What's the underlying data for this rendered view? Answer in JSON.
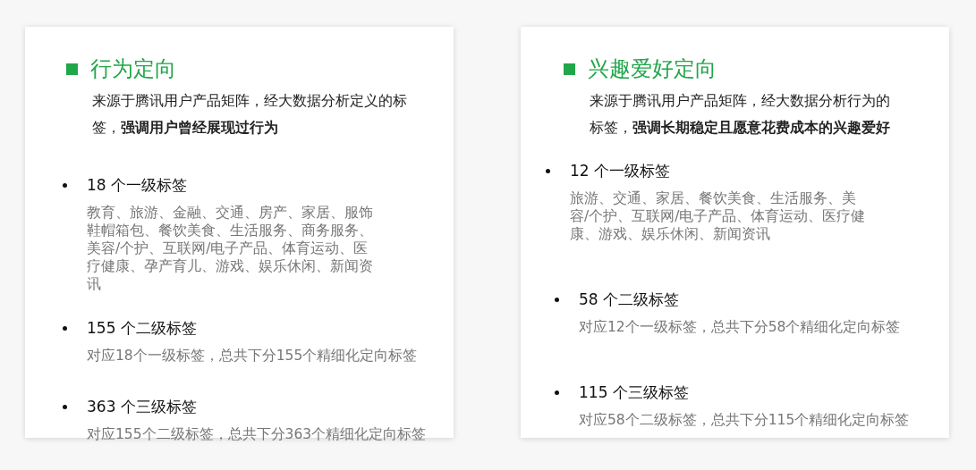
{
  "cards": [
    {
      "title": "行为定向",
      "description": "来源于腾讯用户产品矩阵，经大数据分析定义的标签，**强调用户曾经展现过行为**",
      "tiers": [
        {
          "heading": "18 个一级标签",
          "detail": "教育、旅游、金融、交通、房产、家居、服饰鞋帽箱包、餐饮美食、生活服务、商务服务、美容/个护、互联网/电子产品、体育运动、医疗健康、孕产育儿、游戏、娱乐休闲、新闻资讯"
        },
        {
          "heading": "155 个二级标签",
          "detail": "对应18个一级标签，总共下分155个精细化定向标签"
        },
        {
          "heading": "363 个三级标签",
          "detail": "对应155个二级标签，总共下分363个精细化定向标签"
        }
      ]
    },
    {
      "title": "兴趣爱好定向",
      "description": "来源于腾讯用户产品矩阵，经大数据分析行为的标签，**强调长期稳定且愿意花费成本的兴趣爱好**",
      "tiers": [
        {
          "heading": "12 个一级标签",
          "detail": "旅游、交通、家居、餐饮美食、生活服务、美容/个护、互联网/电子产品、体育运动、医疗健康、游戏、娱乐休闲、新闻资讯"
        },
        {
          "heading": "58 个二级标签",
          "detail": "对应12个一级标签，总共下分58个精细化定向标签"
        },
        {
          "heading": "115 个三级标签",
          "detail": "对应58个二级标签，总共下分115个精细化定向标签"
        }
      ]
    }
  ]
}
